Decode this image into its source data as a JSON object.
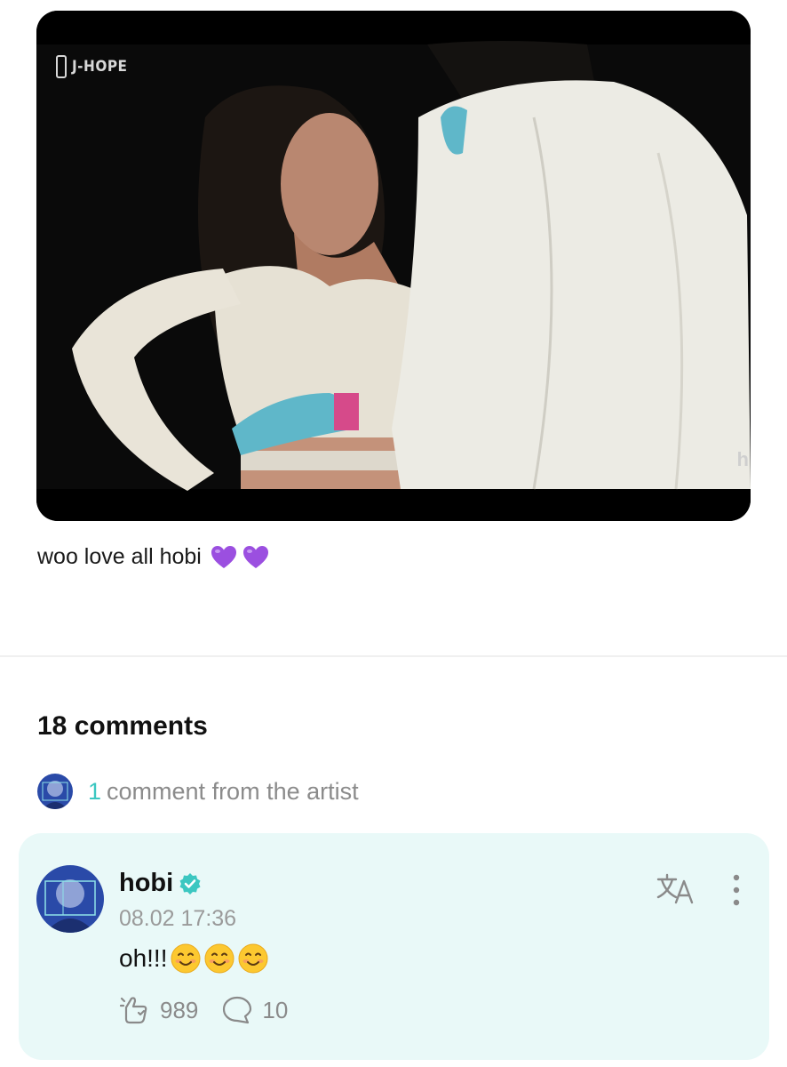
{
  "post": {
    "media": {
      "watermark_left": "J-HOPE",
      "watermark_right": "h"
    },
    "caption": "woo love all hobi",
    "caption_emoji": [
      "purple-heart",
      "purple-heart"
    ]
  },
  "comments": {
    "title": "18 comments",
    "artist_count": "1",
    "artist_text": "comment from the artist",
    "items": [
      {
        "author": "hobi",
        "verified": true,
        "time": "08.02 17:36",
        "text": "oh!!!",
        "emoji": [
          "smiling-face",
          "smiling-face",
          "smiling-face"
        ],
        "likes": "989",
        "replies": "10"
      }
    ]
  },
  "colors": {
    "accent": "#3cc7c1",
    "card_bg": "#e9f9f8",
    "heart": "#9b4fe0"
  }
}
